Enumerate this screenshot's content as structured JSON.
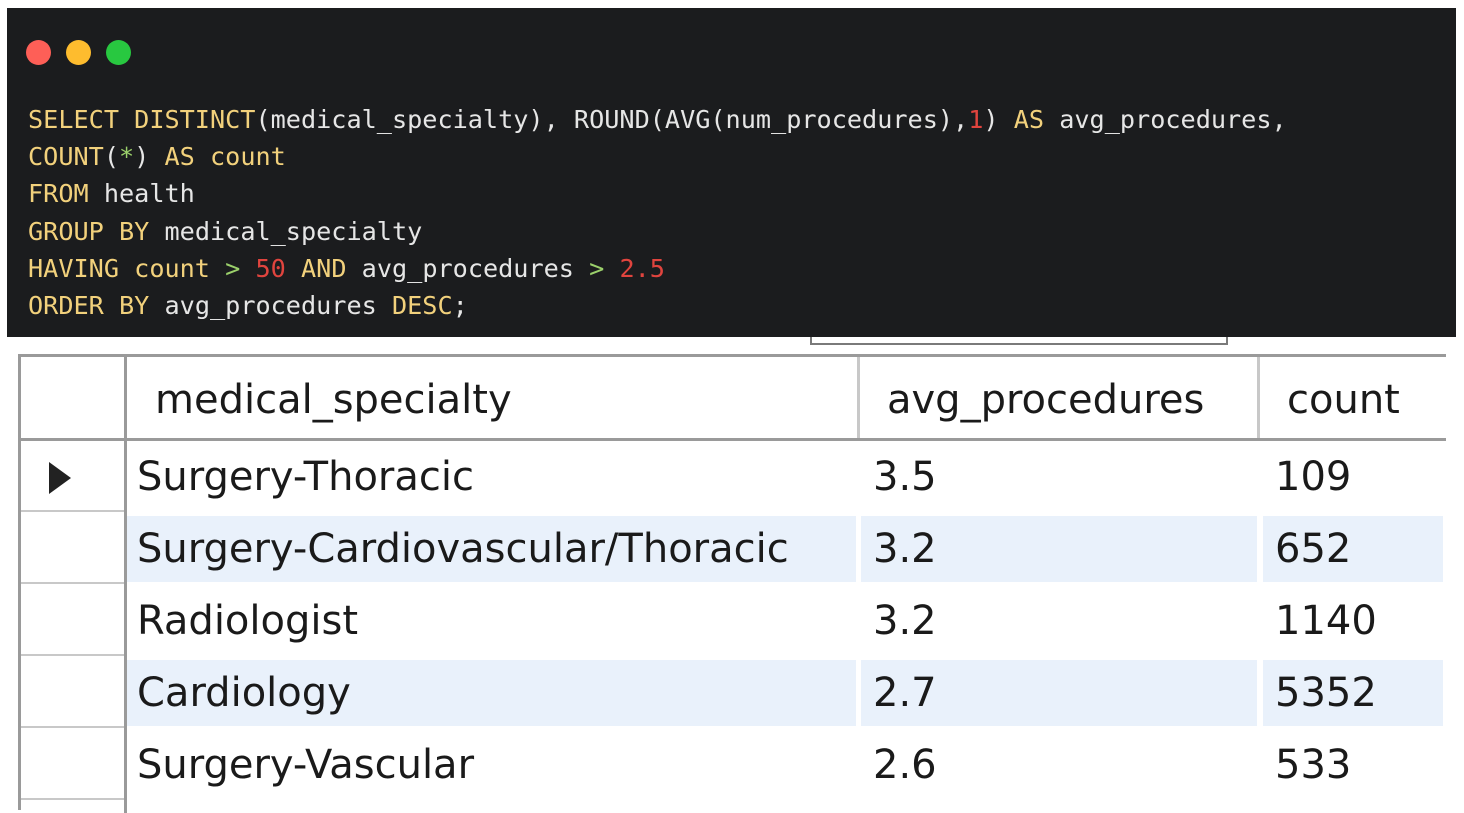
{
  "editor": {
    "window_controls": [
      "close-dot",
      "minimize-dot",
      "zoom-dot"
    ],
    "code_lines": [
      [
        {
          "t": "kw",
          "v": "SELECT DISTINCT"
        },
        {
          "t": "fn",
          "v": "(medical_specialty), ROUND(AVG(num_procedures),"
        },
        {
          "t": "num",
          "v": "1"
        },
        {
          "t": "fn",
          "v": ") "
        },
        {
          "t": "kw",
          "v": "AS"
        },
        {
          "t": "id",
          "v": " avg_procedures,"
        }
      ],
      [
        {
          "t": "kw",
          "v": "COUNT"
        },
        {
          "t": "fn",
          "v": "("
        },
        {
          "t": "op",
          "v": "*"
        },
        {
          "t": "fn",
          "v": ") "
        },
        {
          "t": "kw",
          "v": "AS count"
        }
      ],
      [
        {
          "t": "kw",
          "v": "FROM"
        },
        {
          "t": "id",
          "v": " health"
        }
      ],
      [
        {
          "t": "kw",
          "v": "GROUP BY"
        },
        {
          "t": "id",
          "v": " medical_specialty"
        }
      ],
      [
        {
          "t": "kw",
          "v": "HAVING count"
        },
        {
          "t": "op",
          "v": " > "
        },
        {
          "t": "num",
          "v": "50"
        },
        {
          "t": "kw",
          "v": " AND"
        },
        {
          "t": "id",
          "v": " avg_procedures"
        },
        {
          "t": "op",
          "v": " > "
        },
        {
          "t": "num",
          "v": "2.5"
        }
      ],
      [
        {
          "t": "kw",
          "v": "ORDER BY"
        },
        {
          "t": "id",
          "v": " avg_procedures "
        },
        {
          "t": "kw",
          "v": "DESC"
        },
        {
          "t": "id",
          "v": ";"
        }
      ]
    ]
  },
  "results": {
    "columns": [
      "medical_specialty",
      "avg_procedures",
      "count"
    ],
    "rows": [
      [
        "Surgery-Thoracic",
        "3.5",
        "109"
      ],
      [
        "Surgery-Cardiovascular/Thoracic",
        "3.2",
        "652"
      ],
      [
        "Radiologist",
        "3.2",
        "1140"
      ],
      [
        "Cardiology",
        "2.7",
        "5352"
      ],
      [
        "Surgery-Vascular",
        "2.6",
        "533"
      ]
    ],
    "selected_row": 0
  },
  "colors": {
    "editor_bg": "#1b1c1e",
    "keyword": "#f2d17c",
    "number": "#e0443e",
    "operator": "#9bd06b",
    "row_alt": "#e9f1fb"
  }
}
